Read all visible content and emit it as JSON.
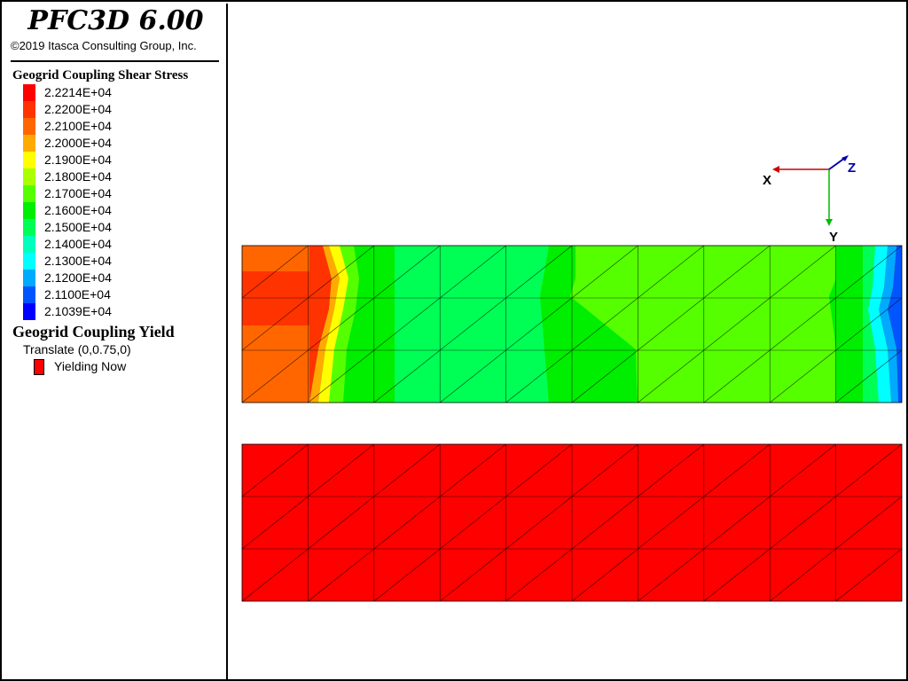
{
  "app": {
    "title": "PFC3D 6.00",
    "copyright": "©2019 Itasca Consulting Group, Inc."
  },
  "legend": {
    "stress_title": "Geogrid Coupling Shear Stress",
    "stress_entries": [
      {
        "label": "2.2214E+04",
        "color": "#ff0000"
      },
      {
        "label": "2.2200E+04",
        "color": "#ff3300"
      },
      {
        "label": "2.2100E+04",
        "color": "#ff6600"
      },
      {
        "label": "2.2000E+04",
        "color": "#ffaa00"
      },
      {
        "label": "2.1900E+04",
        "color": "#ffff00"
      },
      {
        "label": "2.1800E+04",
        "color": "#aaff00"
      },
      {
        "label": "2.1700E+04",
        "color": "#55ff00"
      },
      {
        "label": "2.1600E+04",
        "color": "#00ee00"
      },
      {
        "label": "2.1500E+04",
        "color": "#00ff55"
      },
      {
        "label": "2.1400E+04",
        "color": "#00ffbb"
      },
      {
        "label": "2.1300E+04",
        "color": "#00ffff"
      },
      {
        "label": "2.1200E+04",
        "color": "#00aaff"
      },
      {
        "label": "2.1100E+04",
        "color": "#0055ff"
      },
      {
        "label": "2.1039E+04",
        "color": "#0000ff"
      }
    ],
    "yield_title": "Geogrid Coupling Yield",
    "yield_translate": "Translate (0,0.75,0)",
    "yield_entry": {
      "label": "Yielding Now",
      "color": "#ff0000"
    }
  },
  "axes": {
    "x_label": "X",
    "y_label": "Y",
    "z_label": "Z",
    "x_color": "#cc0000",
    "y_color": "#00bb00",
    "z_color": "#0000aa"
  },
  "mesh_colors": {
    "orange": "#ff6600",
    "red_orange": "#ff3300",
    "yellow": "#ffff00",
    "amber": "#ffaa00",
    "green": "#00ee00",
    "mint": "#00ff55",
    "lime": "#55ff00",
    "cyan": "#00ffff",
    "sky": "#00aaff",
    "blue": "#0055ff",
    "yield_red": "#ff0000"
  }
}
